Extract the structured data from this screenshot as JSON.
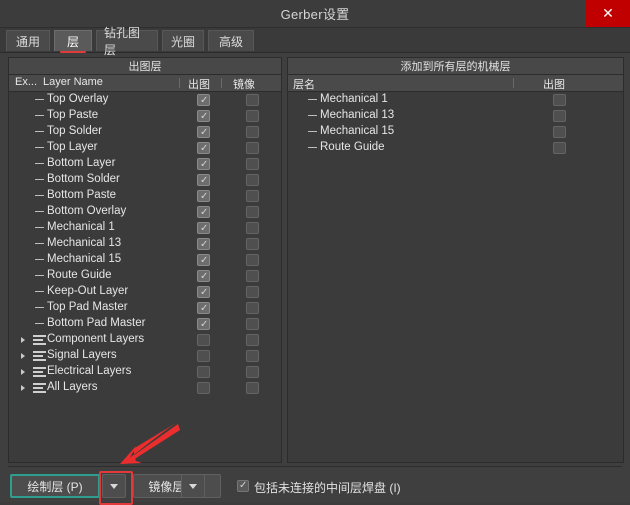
{
  "window": {
    "title": "Gerber设置",
    "close_icon": "close-icon",
    "close_glyph": "✕",
    "accent_red": "#c00000",
    "focus_teal": "#2f9e8f",
    "highlight_red": "#e03a3a"
  },
  "tabs": [
    {
      "label": "通用",
      "active": false
    },
    {
      "label": "层",
      "active": true
    },
    {
      "label": "钻孔图层",
      "active": false
    },
    {
      "label": "光圈",
      "active": false
    },
    {
      "label": "高级",
      "active": false
    }
  ],
  "left_panel": {
    "group_title": "出图层",
    "columns": [
      "Ex...",
      "Layer Name",
      "出图",
      "镜像"
    ],
    "rows": [
      {
        "name": "Top Overlay",
        "type": "layer",
        "plot": true,
        "mirror": false
      },
      {
        "name": "Top Paste",
        "type": "layer",
        "plot": true,
        "mirror": false
      },
      {
        "name": "Top Solder",
        "type": "layer",
        "plot": true,
        "mirror": false
      },
      {
        "name": "Top Layer",
        "type": "layer",
        "plot": true,
        "mirror": false
      },
      {
        "name": "Bottom Layer",
        "type": "layer",
        "plot": true,
        "mirror": false
      },
      {
        "name": "Bottom Solder",
        "type": "layer",
        "plot": true,
        "mirror": false
      },
      {
        "name": "Bottom Paste",
        "type": "layer",
        "plot": true,
        "mirror": false
      },
      {
        "name": "Bottom Overlay",
        "type": "layer",
        "plot": true,
        "mirror": false
      },
      {
        "name": "Mechanical 1",
        "type": "layer",
        "plot": true,
        "mirror": false
      },
      {
        "name": "Mechanical 13",
        "type": "layer",
        "plot": true,
        "mirror": false
      },
      {
        "name": "Mechanical 15",
        "type": "layer",
        "plot": true,
        "mirror": false
      },
      {
        "name": "Route Guide",
        "type": "layer",
        "plot": true,
        "mirror": false
      },
      {
        "name": "Keep-Out Layer",
        "type": "layer",
        "plot": true,
        "mirror": false
      },
      {
        "name": "Top Pad Master",
        "type": "layer",
        "plot": true,
        "mirror": false
      },
      {
        "name": "Bottom Pad Master",
        "type": "layer",
        "plot": true,
        "mirror": false
      },
      {
        "name": "Component Layers",
        "type": "group",
        "plot": false,
        "mirror": false
      },
      {
        "name": "Signal Layers",
        "type": "group",
        "plot": false,
        "mirror": false
      },
      {
        "name": "Electrical Layers",
        "type": "group",
        "plot": false,
        "mirror": false
      },
      {
        "name": "All Layers",
        "type": "group",
        "plot": false,
        "mirror": false
      }
    ]
  },
  "right_panel": {
    "group_title": "添加到所有层的机械层",
    "columns": [
      "层名",
      "出图"
    ],
    "rows": [
      {
        "name": "Mechanical 1",
        "plot": false
      },
      {
        "name": "Mechanical 13",
        "plot": false
      },
      {
        "name": "Mechanical 15",
        "plot": false
      },
      {
        "name": "Route Guide",
        "plot": false
      }
    ]
  },
  "bottom": {
    "plot_layers_button": "绘制层 (P)",
    "mirror_layers_button": "镜像层 (M)",
    "include_pads_label": "包括未连接的中间层焊盘 (I)",
    "include_pads_checked": true,
    "dropdown_icon": "chevron-down-icon"
  }
}
